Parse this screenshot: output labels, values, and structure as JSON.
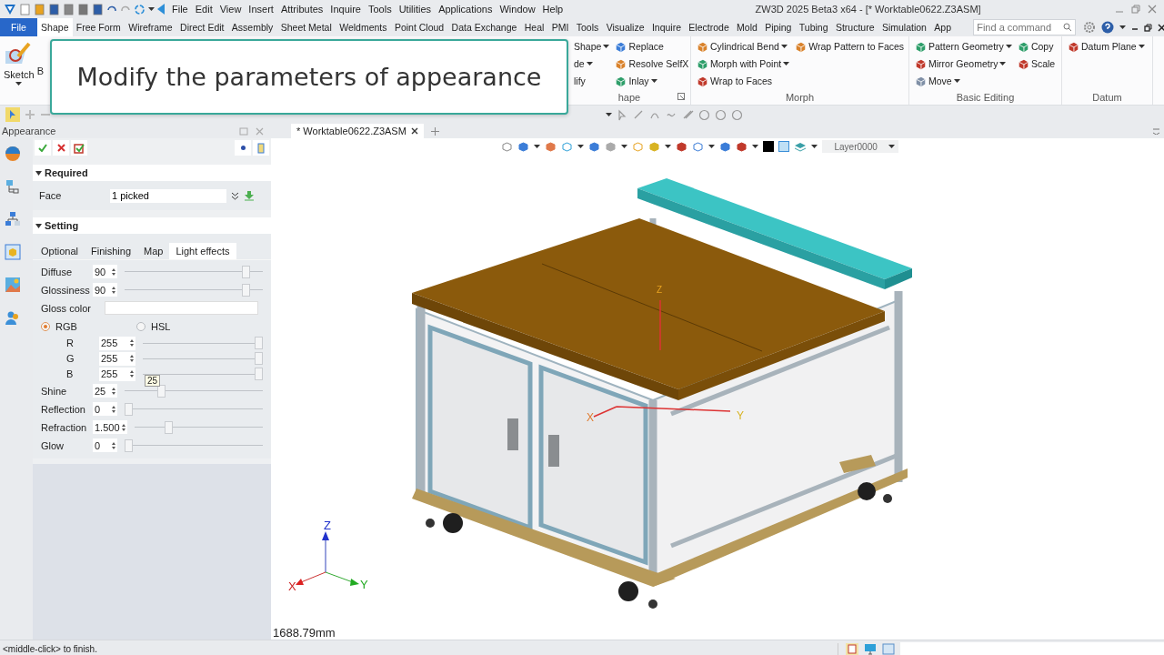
{
  "title_bar": {
    "menu": [
      "File",
      "Edit",
      "View",
      "Insert",
      "Attributes",
      "Inquire",
      "Tools",
      "Utilities",
      "Applications",
      "Window",
      "Help"
    ],
    "title": "ZW3D 2025 Beta3 x64 - [* Worktable0622.Z3ASM]"
  },
  "ribbon_tabs": [
    {
      "label": "File",
      "kind": "file",
      "selected": false
    },
    {
      "label": "Shape",
      "kind": "tab",
      "selected": true
    },
    {
      "label": "Free Form",
      "kind": "tab",
      "selected": false
    },
    {
      "label": "Wireframe",
      "kind": "tab",
      "selected": false
    },
    {
      "label": "Direct Edit",
      "kind": "tab",
      "selected": false
    },
    {
      "label": "Assembly",
      "kind": "tab",
      "selected": false
    },
    {
      "label": "Sheet Metal",
      "kind": "tab",
      "selected": false
    },
    {
      "label": "Weldments",
      "kind": "tab",
      "selected": false
    },
    {
      "label": "Point Cloud",
      "kind": "tab",
      "selected": false
    },
    {
      "label": "Data Exchange",
      "kind": "tab",
      "selected": false
    },
    {
      "label": "Heal",
      "kind": "tab",
      "selected": false
    },
    {
      "label": "PMI",
      "kind": "tab",
      "selected": false
    },
    {
      "label": "Tools",
      "kind": "tab",
      "selected": false
    },
    {
      "label": "Visualize",
      "kind": "tab",
      "selected": false
    },
    {
      "label": "Inquire",
      "kind": "tab",
      "selected": false
    },
    {
      "label": "Electrode",
      "kind": "tab",
      "selected": false
    },
    {
      "label": "Mold",
      "kind": "tab",
      "selected": false
    },
    {
      "label": "Piping",
      "kind": "tab",
      "selected": false
    },
    {
      "label": "Tubing",
      "kind": "tab",
      "selected": false
    },
    {
      "label": "Structure",
      "kind": "tab",
      "selected": false
    },
    {
      "label": "Simulation",
      "kind": "tab",
      "selected": false
    },
    {
      "label": "App",
      "kind": "tab",
      "selected": false
    }
  ],
  "command_search": {
    "placeholder": "Find a command"
  },
  "ribbon": {
    "sketch": {
      "label": "Sketch"
    },
    "partial_label": "B",
    "groups": [
      {
        "label": "hape",
        "columns": [
          [
            {
              "label": "Shape",
              "dropdown": true
            },
            {
              "label": "de",
              "dropdown": true
            },
            {
              "label": "lify",
              "dropdown": false
            }
          ],
          [
            {
              "label": "Replace",
              "dropdown": false
            },
            {
              "label": "Resolve SelfX",
              "dropdown": false
            },
            {
              "label": "Inlay",
              "dropdown": true
            }
          ]
        ]
      },
      {
        "label": "Morph",
        "columns": [
          [
            {
              "label": "Cylindrical Bend",
              "dropdown": true
            },
            {
              "label": "Morph with Point",
              "dropdown": true
            },
            {
              "label": "Wrap to Faces",
              "dropdown": false
            }
          ],
          [
            {
              "label": "Wrap Pattern to Faces",
              "dropdown": false
            }
          ]
        ]
      },
      {
        "label": "Basic Editing",
        "columns": [
          [
            {
              "label": "Pattern Geometry",
              "dropdown": true
            },
            {
              "label": "Mirror Geometry",
              "dropdown": true
            },
            {
              "label": "Move",
              "dropdown": true
            }
          ],
          [
            {
              "label": "Copy",
              "dropdown": false
            },
            {
              "label": "Scale",
              "dropdown": false
            }
          ]
        ]
      },
      {
        "label": "Datum",
        "columns": [
          [
            {
              "label": "Datum Plane",
              "dropdown": true
            }
          ]
        ]
      }
    ]
  },
  "callout": {
    "text": "Modify the parameters of appearance"
  },
  "panel": {
    "title": "Appearance",
    "required": {
      "title": "Required",
      "expanded": true,
      "field": {
        "label": "Face",
        "value": "1 picked"
      }
    },
    "setting": {
      "title": "Setting",
      "expanded": true,
      "tabs": [
        {
          "label": "Optional",
          "selected": false
        },
        {
          "label": "Finishing",
          "selected": false
        },
        {
          "label": "Map",
          "selected": false
        },
        {
          "label": "Light effects",
          "selected": true
        }
      ],
      "rows": [
        {
          "kind": "slider",
          "label": "Diffuse",
          "value": "90",
          "level": 0.9
        },
        {
          "kind": "slider",
          "label": "Glossiness",
          "value": "90",
          "level": 0.9
        },
        {
          "kind": "color",
          "label": "Gloss color"
        },
        {
          "kind": "radio",
          "options": [
            {
              "label": "RGB",
              "selected": true
            },
            {
              "label": "HSL",
              "selected": false
            }
          ]
        },
        {
          "kind": "channel",
          "label": "R",
          "value": "255",
          "level": 1
        },
        {
          "kind": "channel",
          "label": "G",
          "value": "255",
          "level": 1
        },
        {
          "kind": "channel",
          "label": "B",
          "value": "255",
          "level": 1
        },
        {
          "kind": "slider",
          "label": "Shine",
          "value": "25",
          "level": 0.25,
          "tooltip": "25"
        },
        {
          "kind": "slider",
          "label": "Reflection",
          "value": "0",
          "level": 0
        },
        {
          "kind": "slider",
          "label": "Refraction",
          "value": "1.500",
          "level": 0.25
        },
        {
          "kind": "slider",
          "label": "Glow",
          "value": "0",
          "level": 0
        }
      ]
    }
  },
  "viewport": {
    "document_tabs": [
      {
        "label": "* Worktable0622.Z3ASM",
        "selected": true
      }
    ],
    "layer_select": {
      "value": "Layer0000"
    },
    "part_axis_labels": [
      "X",
      "Y",
      "Z"
    ],
    "triad_labels": [
      "X",
      "Y",
      "Z"
    ],
    "measurement": "1688.79mm"
  },
  "status_bar": {
    "message": "<middle-click> to finish."
  }
}
